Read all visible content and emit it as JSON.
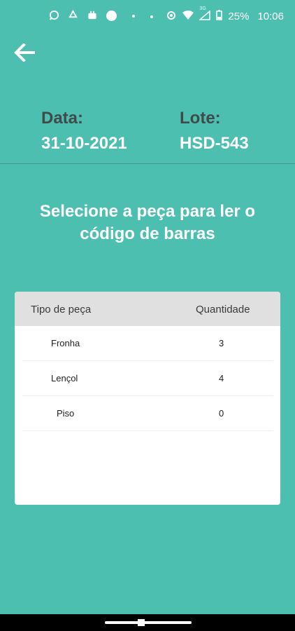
{
  "status_bar": {
    "battery": "25%",
    "time": "10:06",
    "network": "3G",
    "icons": [
      "whatsapp-icon",
      "recycle-icon",
      "robot-icon",
      "circle-icon",
      "dot-icon",
      "dot-icon",
      "eye-icon",
      "wifi-icon",
      "signal-icon",
      "battery-icon"
    ]
  },
  "header": {
    "data_label": "Data:",
    "data_value": "31-10-2021",
    "lote_label": "Lote:",
    "lote_value": "HSD-543"
  },
  "instruction": "Selecione a peça para ler o código de barras",
  "table": {
    "col_type": "Tipo de peça",
    "col_qty": "Quantidade",
    "rows": [
      {
        "name": "Fronha",
        "qty": "3"
      },
      {
        "name": "Lençol",
        "qty": "4"
      },
      {
        "name": "Piso",
        "qty": "0"
      }
    ]
  },
  "colors": {
    "background": "#4DBFB0",
    "label_dark": "#3f4a4a",
    "header_gray": "#E0E0E0"
  }
}
